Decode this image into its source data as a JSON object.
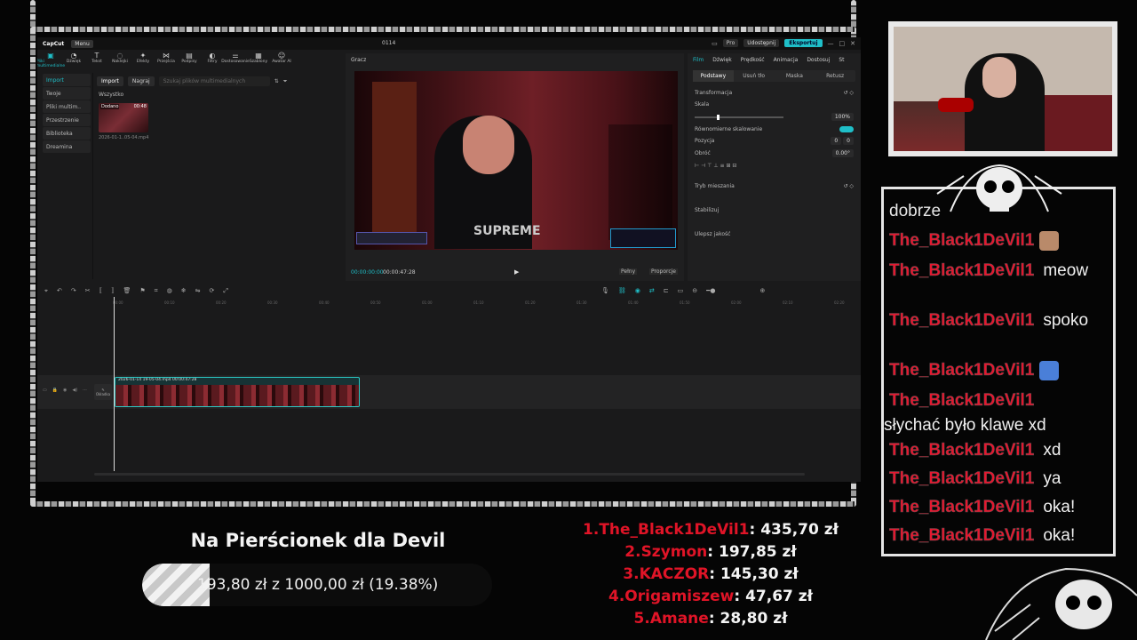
{
  "capcut": {
    "logo": "CapCut",
    "menu": "Menu",
    "project_name": "0114",
    "pro": "Pro",
    "share": "Udostępnij",
    "export": "Eksportuj",
    "toolbar": [
      "Pliki multimedialne",
      "Dźwięk",
      "Tekst",
      "Naklejki",
      "Efekty",
      "Przejścia",
      "Podpisy",
      "Filtry",
      "Dostosowanie",
      "Szablony",
      "Awatar AI"
    ],
    "left_nav": [
      "Import",
      "Twoje",
      "Pliki multim..",
      "Przestrzenie",
      "Biblioteka",
      "Dreamina"
    ],
    "import_btn": "Import",
    "record_btn": "Nagraj",
    "search_placeholder": "Szukaj plików multimedialnych",
    "all_label": "Wszystko",
    "thumb_badge": "Dodano",
    "thumb_duration": "00:48",
    "thumb_name": "2026-01-1..05-04.mp4",
    "player_title": "Gracz",
    "time_current": "00:00:00:00",
    "time_total": "00:00:47:28",
    "ratio_btn": "Pełny",
    "ratio_btn2": "Proporcje",
    "insp_tabs": [
      "Film",
      "Dźwięk",
      "Prędkość",
      "Animacja",
      "Dostosuj",
      "St"
    ],
    "insp_sub": [
      "Podstawy",
      "Usuń tło",
      "Maska",
      "Retusz"
    ],
    "transform": "Transformacja",
    "scale": "Skala",
    "scale_value": "100%",
    "uniform": "Równomierne skalowanie",
    "position": "Pozycja",
    "pos_x": "0",
    "pos_y": "0",
    "rotate": "Obróć",
    "rotate_value": "0.00°",
    "blend": "Tryb mieszania",
    "stabilize": "Stabilizuj",
    "enhance": "Ulepsz jakość",
    "ruler": [
      "00:00",
      "00:10",
      "00:20",
      "00:30",
      "00:40",
      "00:50",
      "01:00",
      "01:10",
      "01:20",
      "01:30",
      "01:40",
      "01:50",
      "02:00",
      "02:10",
      "02:20"
    ],
    "cover_label": "Okładka",
    "clip_name": "2026-01-14 19-05-04.mp4  00:00:47:28",
    "video_brand": "SUPREME"
  },
  "chat": [
    {
      "user": "The_Black1DeVil1",
      "msg": "",
      "emote": "cat-emote",
      "emote_color": "#b98a6a"
    },
    {
      "user": "The_Black1DeVil1",
      "msg": "meow",
      "emote": ""
    },
    {
      "user": "The_Black1DeVil1",
      "msg": "spoko",
      "emote": ""
    },
    {
      "user": "The_Black1DeVil1",
      "msg": "",
      "emote": "butterfly-emote",
      "emote_color": "#4a7fd8"
    },
    {
      "user": "The_Black1DeVil1",
      "msg": "słychać było klawe xd",
      "emote": ""
    },
    {
      "user": "The_Black1DeVil1",
      "msg": "xd",
      "emote": ""
    },
    {
      "user": "The_Black1DeVil1",
      "msg": "ya",
      "emote": ""
    },
    {
      "user": "The_Black1DeVil1",
      "msg": "oka!",
      "emote": ""
    },
    {
      "user": "The_Black1DeVil1",
      "msg": "oka!",
      "emote": ""
    }
  ],
  "chat_top_partial": "dobrze",
  "goal": {
    "title": "Na Pierścionek dla Devil",
    "text": "193,80 zł  z  1000,00 zł (19.38%)",
    "progress": 0.1938
  },
  "leaderboard": [
    {
      "rank": "1.",
      "name": "The_Black1DeVil1",
      "amount": ": 435,70 zł"
    },
    {
      "rank": "2.",
      "name": "Szymon",
      "amount": ": 197,85 zł"
    },
    {
      "rank": "3.",
      "name": "KACZOR",
      "amount": ": 145,30 zł"
    },
    {
      "rank": "4.",
      "name": "Origamiszew",
      "amount": ": 47,67 zł"
    },
    {
      "rank": "5.",
      "name": "Amane",
      "amount": ": 28,80 zł"
    }
  ],
  "colors": {
    "accent": "#1fbfc8",
    "username": "#e01427",
    "frame": "#e6e6e6"
  }
}
